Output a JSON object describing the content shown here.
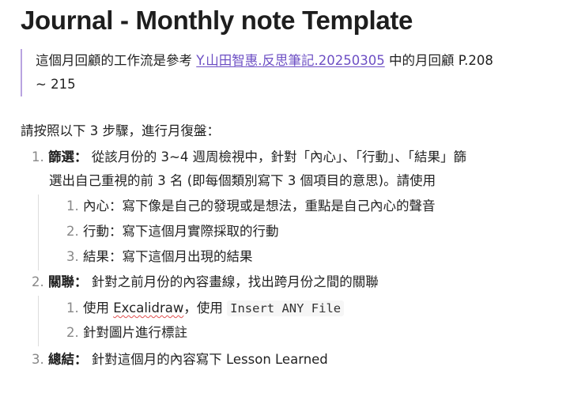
{
  "title": "Journal - Monthly note Template",
  "quote": {
    "prefix": "這個月回顧的工作流是參考 ",
    "link_text": "Y.山田智惠.反思筆記.20250305",
    "suffix_line1": " 中的月回顧 P.208",
    "line2": "~ 215"
  },
  "intro": "請按照以下 3 步驟，進行月復盤：",
  "steps": [
    {
      "num": "1.",
      "label": "篩選：",
      "text_line1": " 從該月份的 3~4 週周檢視中，針對「內心」、「行動」、「結果」篩",
      "text_line2": "選出自己重視的前 3 名 (即每個類別寫下 3 個項目的意思)。請使用",
      "sub": [
        {
          "num": "1.",
          "text": "內心：寫下像是自己的發現或是想法，重點是自己內心的聲音"
        },
        {
          "num": "2.",
          "text": "行動：寫下這個月實際採取的行動"
        },
        {
          "num": "3.",
          "text": "結果：寫下這個月出現的結果"
        }
      ]
    },
    {
      "num": "2.",
      "label": "關聯：",
      "text_line1": " 針對之前月份的內容畫線，找出跨月份之間的關聯",
      "sub": [
        {
          "num": "1.",
          "pre": "使用 ",
          "spell": "Excalidraw",
          "mid": "，使用 ",
          "code": "Insert ANY File"
        },
        {
          "num": "2.",
          "text": "針對圖片進行標註"
        }
      ]
    },
    {
      "num": "3.",
      "label": "總結：",
      "text_line1": " 針對這個月的內容寫下 Lesson Learned"
    }
  ],
  "colors": {
    "link": "#6d4fc4",
    "quote_border": "#b9a3e0",
    "list_number": "#888888",
    "spellcheck": "#e05050"
  }
}
